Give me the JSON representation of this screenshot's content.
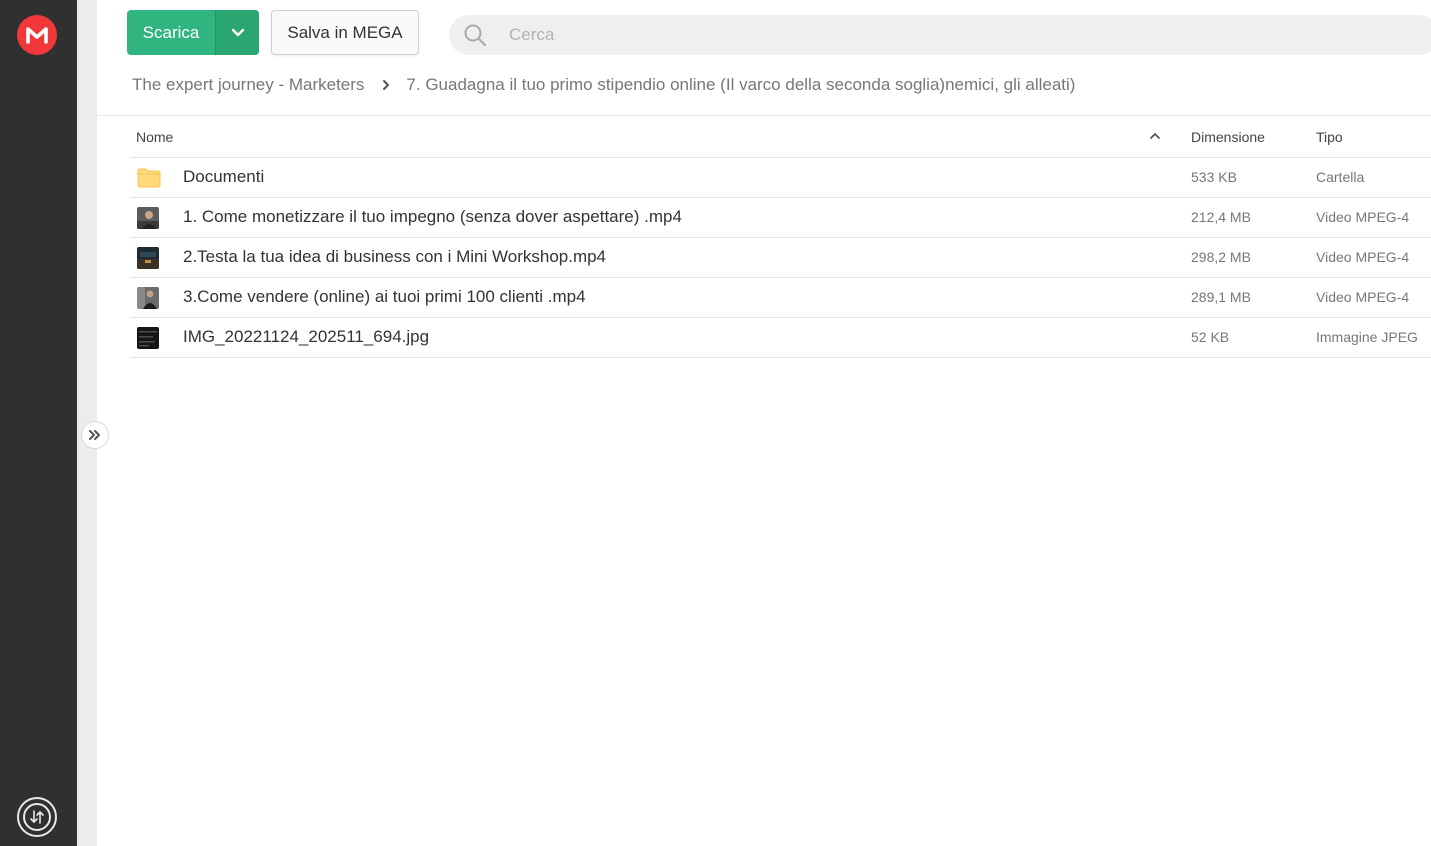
{
  "app": {
    "logo_letter": "M",
    "brand_color": "#f0373a",
    "accent_green": "#31b580"
  },
  "toolbar": {
    "download_label": "Scarica",
    "download_dropdown_icon": "chevron-down-icon",
    "save_label": "Salva in MEGA"
  },
  "search": {
    "placeholder": "Cerca",
    "value": ""
  },
  "breadcrumb": {
    "items": [
      "The expert journey - Marketers",
      "7. Guadagna il tuo primo stipendio online (Il varco della seconda soglia)nemici, gli alleati)"
    ]
  },
  "table": {
    "headers": {
      "name": "Nome",
      "size": "Dimensione",
      "type": "Tipo"
    },
    "sort": "ascending",
    "rows": [
      {
        "icon": "folder-icon",
        "name": "Documenti",
        "size": "533 KB",
        "type": "Cartella"
      },
      {
        "icon": "video-thumbnail",
        "name": "1. Come monetizzare il tuo impegno (senza dover aspettare) .mp4",
        "size": "212,4 MB",
        "type": "Video MPEG-4"
      },
      {
        "icon": "video-thumbnail",
        "name": "2.Testa la tua idea di business con i Mini Workshop.mp4",
        "size": "298,2 MB",
        "type": "Video MPEG-4"
      },
      {
        "icon": "video-thumbnail",
        "name": "3.Come vendere (online) ai tuoi primi 100 clienti .mp4",
        "size": "289,1 MB",
        "type": "Video MPEG-4"
      },
      {
        "icon": "image-thumbnail",
        "name": "IMG_20221124_202511_694.jpg",
        "size": "52 KB",
        "type": "Immagine JPEG"
      }
    ]
  }
}
